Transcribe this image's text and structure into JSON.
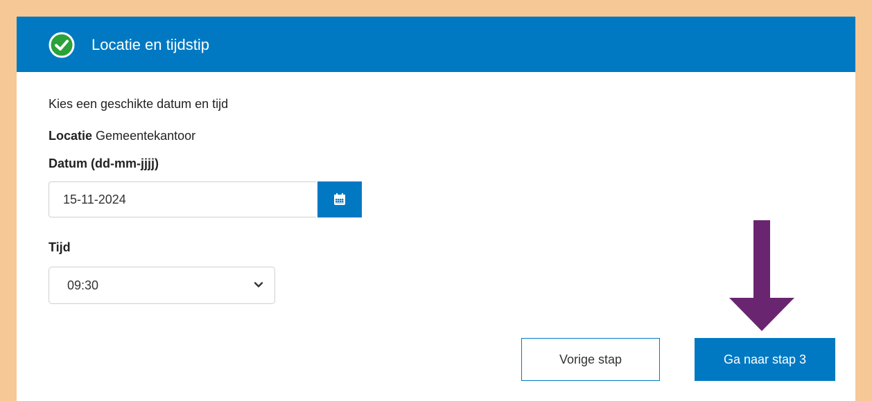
{
  "header": {
    "title": "Locatie en tijdstip",
    "icon": "check-circle-icon",
    "color": "#0079c2"
  },
  "form": {
    "intro": "Kies een geschikte datum en tijd",
    "location_label": "Locatie",
    "location_value": "Gemeentekantoor",
    "date_label": "Datum (dd-mm-jjjj)",
    "date_value": "15-11-2024",
    "calendar_icon": "calendar-icon",
    "time_label": "Tijd",
    "time_value": "09:30"
  },
  "actions": {
    "prev_label": "Vorige stap",
    "next_label": "Ga naar stap 3"
  },
  "annotation": {
    "icon": "down-arrow-icon",
    "color": "#6a2570"
  },
  "colors": {
    "background": "#f5c895",
    "accent": "#0079c2",
    "success": "#2aa13a"
  }
}
